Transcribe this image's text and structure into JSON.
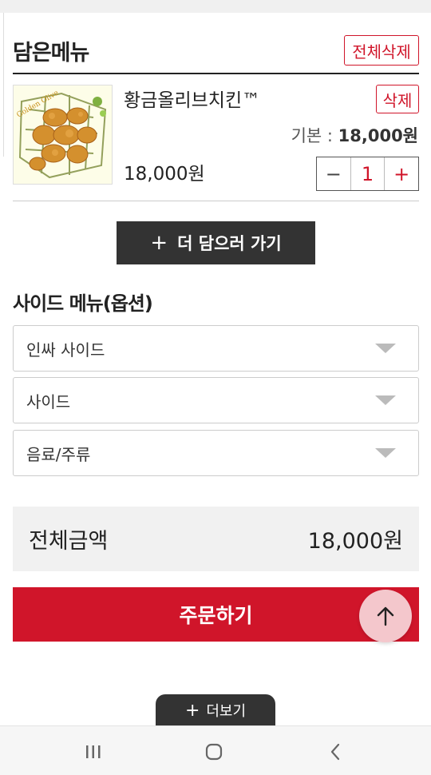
{
  "cart": {
    "title": "담은메뉴",
    "delete_all_label": "전체삭제",
    "item": {
      "name": "황금올리브치킨™",
      "delete_label": "삭제",
      "base_label": "기본 : ",
      "base_price": "18,000원",
      "price": "18,000원",
      "quantity": "1",
      "minus_symbol": "−",
      "plus_symbol": "+",
      "image_icon": "fried-chicken-photo"
    },
    "add_more_label": "더 담으러 가기",
    "add_more_icon": "plus-icon"
  },
  "side_menu": {
    "title": "사이드 메뉴(옵션)",
    "selects": [
      {
        "value": "인싸 사이드"
      },
      {
        "value": "사이드"
      },
      {
        "value": "음료/주류"
      }
    ]
  },
  "total": {
    "label": "전체금액",
    "amount": "18,000원"
  },
  "order_button_label": "주문하기",
  "scroll_top_icon": "arrow-up-icon",
  "view_more_label": "더보기",
  "nav": {
    "recent_icon": "recent-apps-icon",
    "home_icon": "home-icon",
    "back_icon": "back-icon"
  },
  "colors": {
    "accent": "#d0152a",
    "dark_button": "#333333",
    "fab": "#f4c7cc"
  }
}
